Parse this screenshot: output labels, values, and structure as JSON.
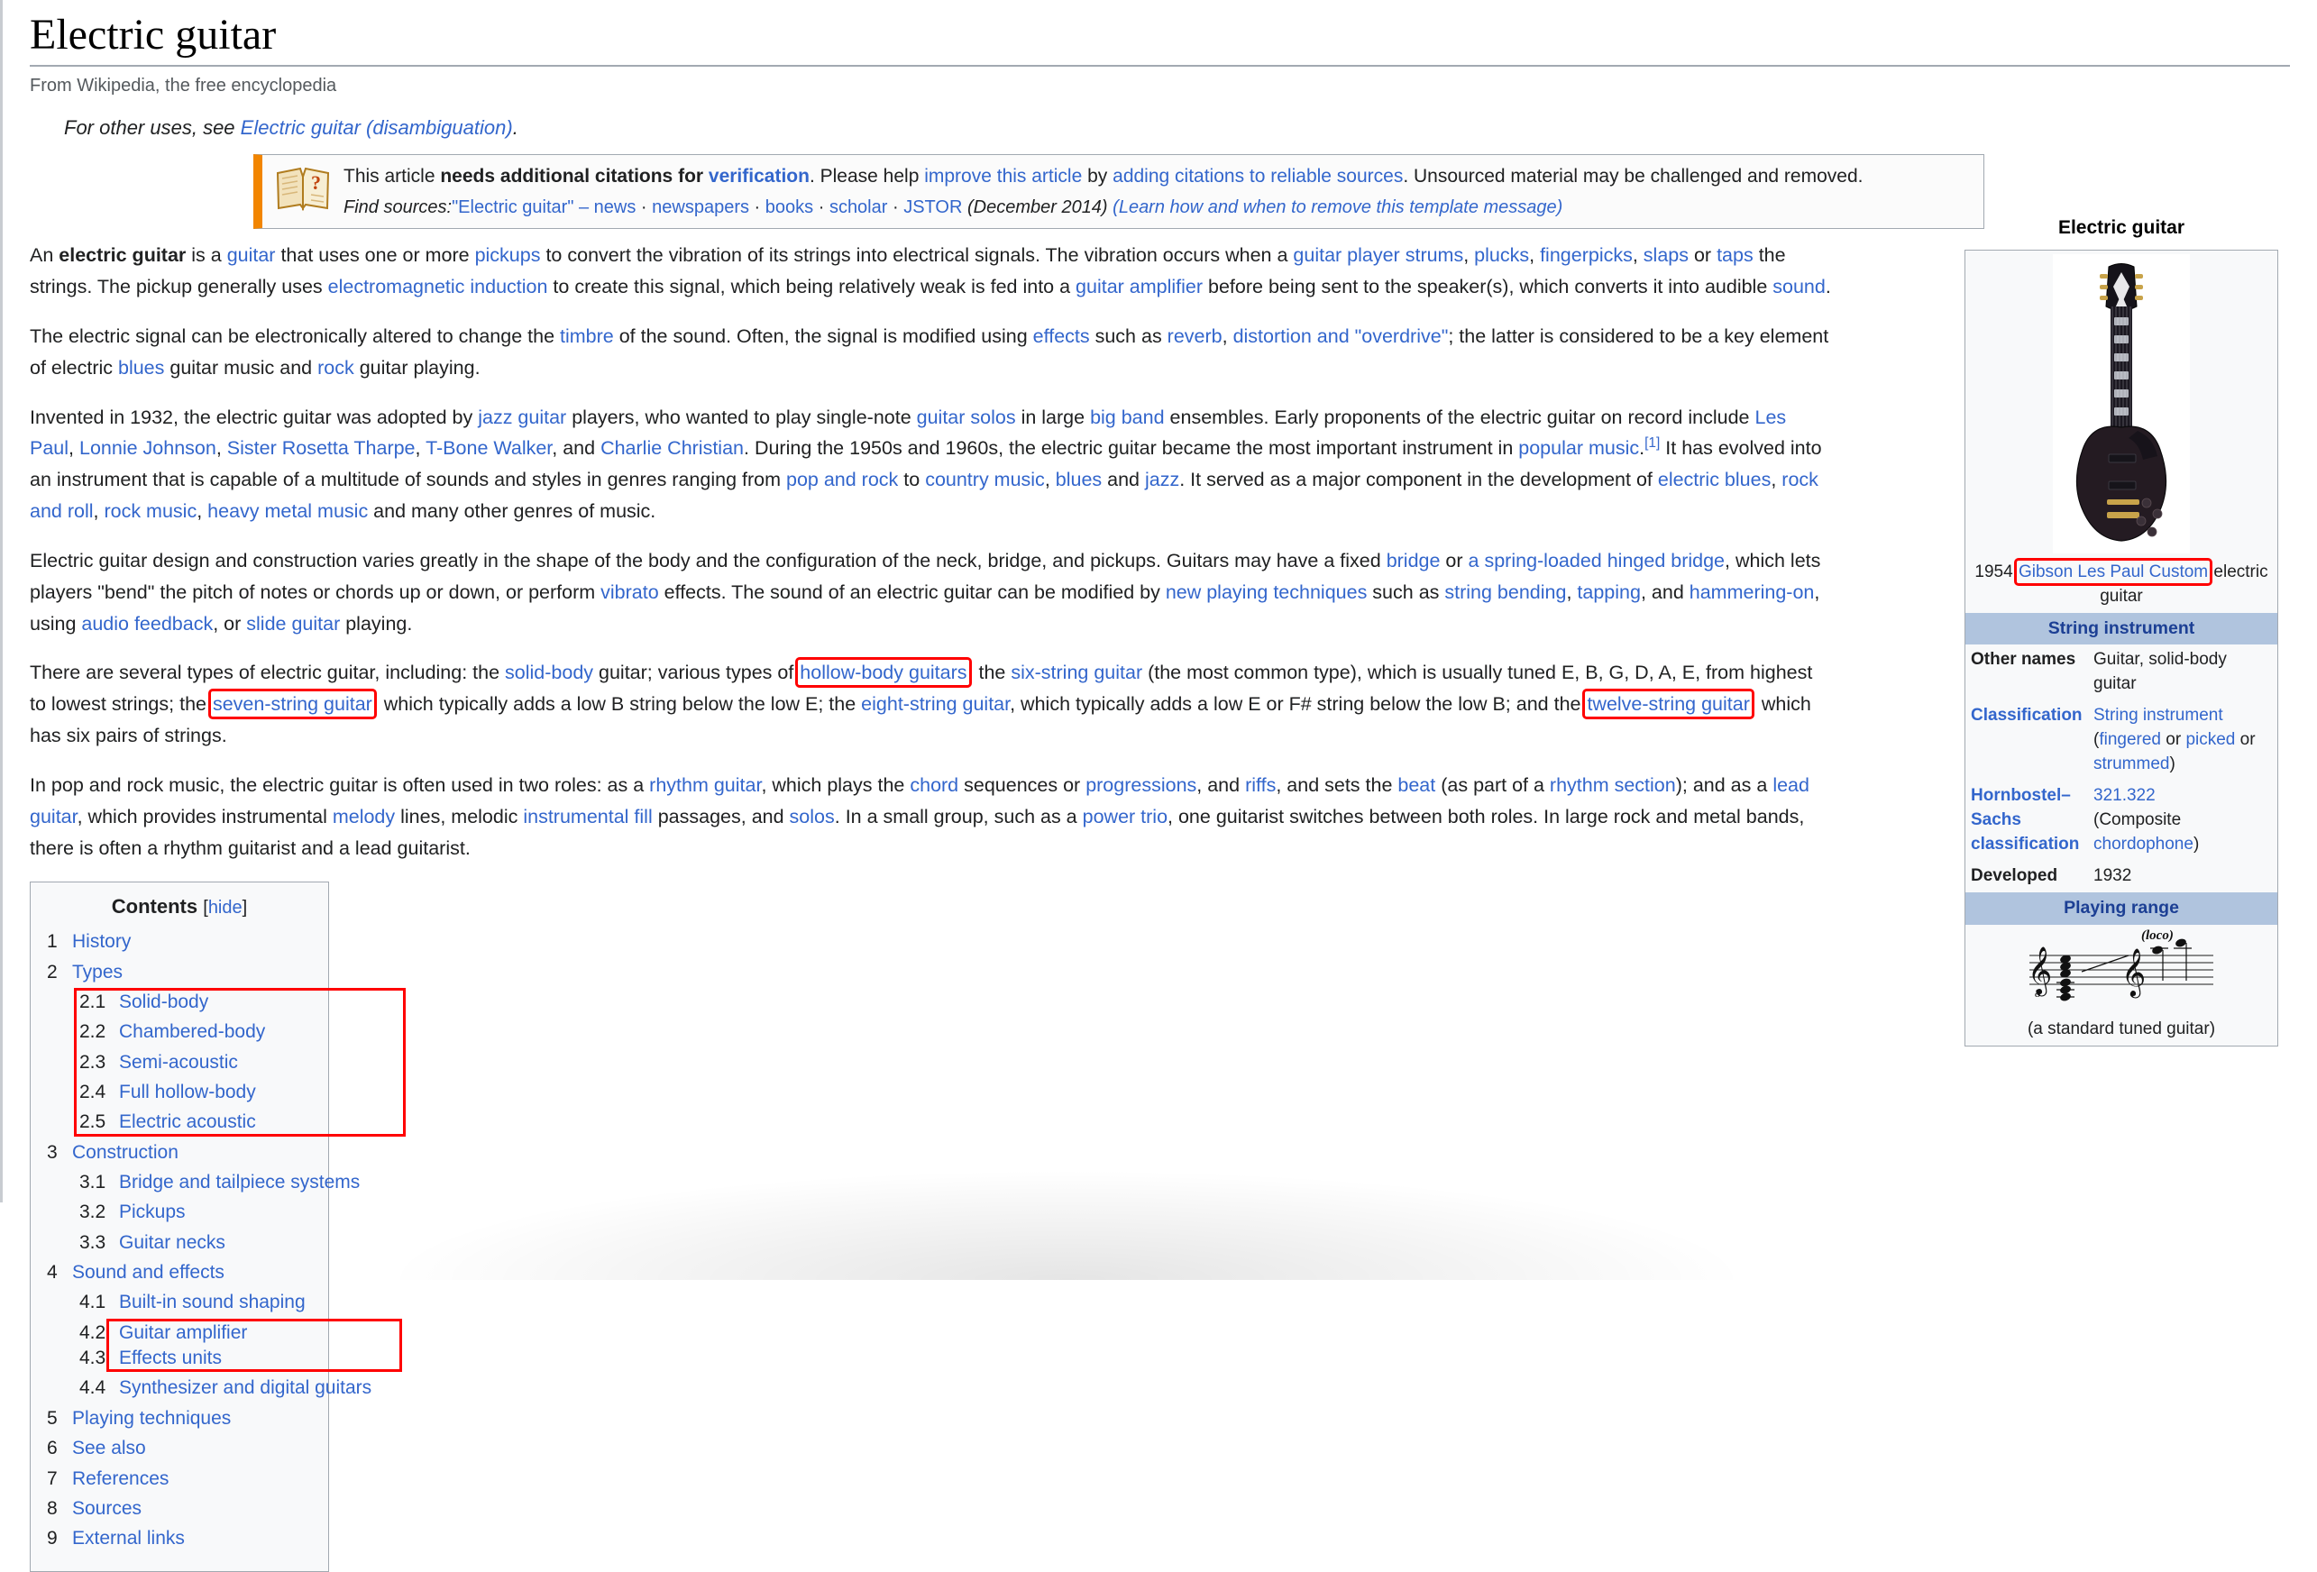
{
  "article": {
    "title": "Electric guitar",
    "tagline": "From Wikipedia, the free encyclopedia",
    "hatnote_prefix": "For other uses, see ",
    "hatnote_link": "Electric guitar (disambiguation)",
    "hatnote_suffix": "."
  },
  "ambox": {
    "icon": "open-book-question-icon",
    "line1_a": "This article ",
    "line1_b_bold": "needs additional citations for ",
    "line1_c_boldlink": "verification",
    "line1_d": ". Please help ",
    "line1_e_link": "improve this article",
    "line1_f": " by ",
    "line1_g_link": "adding citations to reliable sources",
    "line1_h": ". Unsourced material may be challenged and removed.",
    "find_sources_label": "Find sources:",
    "find_sources_query": "\"Electric guitar\"",
    "dash": "–",
    "sources": [
      "news",
      "newspapers",
      "books",
      "scholar",
      "JSTOR"
    ],
    "date": "(December 2014)",
    "learn_more": "(Learn how and when to remove this template message)"
  },
  "paragraphs": {
    "p1": {
      "t1": "An ",
      "bold1": "electric guitar",
      "t2": " is a ",
      "l1": "guitar",
      "t3": " that uses one or more ",
      "l2": "pickups",
      "t4": " to convert the vibration of its strings into electrical signals. The vibration occurs when a ",
      "l3": "guitar player",
      "t5": " ",
      "l4": "strums",
      "t6": ", ",
      "l5": "plucks",
      "t7": ", ",
      "l6": "fingerpicks",
      "t8": ", ",
      "l7": "slaps",
      "t9": " or ",
      "l8": "taps",
      "t10": " the strings. The pickup generally uses ",
      "l9": "electromagnetic induction",
      "t11": " to create this signal, which being relatively weak is fed into a ",
      "l10": "guitar amplifier",
      "t12": " before being sent to the speaker(s), which converts it into audible ",
      "l11": "sound",
      "t13": "."
    },
    "p2": {
      "t1": "The electric signal can be electronically altered to change the ",
      "l1": "timbre",
      "t2": " of the sound. Often, the signal is modified using ",
      "l2": "effects",
      "t3": " such as ",
      "l3": "reverb",
      "t4": ", ",
      "l4": "distortion and \"overdrive\"",
      "t5": "; the latter is considered to be a key element of electric ",
      "l5": "blues",
      "t6": " guitar music and ",
      "l6": "rock",
      "t7": " guitar playing."
    },
    "p3": {
      "t1": "Invented in 1932, the electric guitar was adopted by ",
      "l1": "jazz guitar",
      "t2": " players, who wanted to play single-note ",
      "l2": "guitar solos",
      "t3": " in large ",
      "l3": "big band",
      "t4": " ensembles. Early proponents of the electric guitar on record include ",
      "l4": "Les Paul",
      "t5": ", ",
      "l5": "Lonnie Johnson",
      "t6": ", ",
      "l6": "Sister Rosetta Tharpe",
      "t7": ", ",
      "l7": "T-Bone Walker",
      "t8": ", and ",
      "l8": "Charlie Christian",
      "t9": ". During the 1950s and 1960s, the electric guitar became the most important instrument in ",
      "l9": "popular music",
      "ref": "[1]",
      "t10": " It has evolved into an instrument that is capable of a multitude of sounds and styles in genres ranging from ",
      "l10": "pop and rock",
      "t11": " to ",
      "l11": "country music",
      "t12": ", ",
      "l12": "blues",
      "t13": " and ",
      "l13": "jazz",
      "t14": ". It served as a major component in the development of ",
      "l14": "electric blues",
      "t15": ", ",
      "l15": "rock and roll",
      "t16": ", ",
      "l16": "rock music",
      "t17": ", ",
      "l17": "heavy metal music",
      "t18": " and many other genres of music."
    },
    "p4": {
      "t1": "Electric guitar design and construction varies greatly in the shape of the body and the configuration of the neck, bridge, and pickups. Guitars may have a fixed ",
      "l1": "bridge",
      "t2": " or ",
      "l2": "a spring-loaded hinged bridge",
      "t3": ", which lets players \"bend\" the pitch of notes or chords up or down, or perform ",
      "l3": "vibrato",
      "t4": " effects. The sound of an electric guitar can be modified by ",
      "l4": "new playing techniques",
      "t5": " such as ",
      "l5": "string bending",
      "t6": ", ",
      "l6": "tapping",
      "t7": ", and ",
      "l7": "hammering-on",
      "t8": ", using ",
      "l8": "audio feedback",
      "t9": ", or ",
      "l9": "slide guitar",
      "t10": " playing."
    },
    "p5": {
      "t1": "There are several types of electric guitar, including: the ",
      "l1": "solid-body",
      "t2": " guitar; various types of ",
      "l2_boxed": "hollow-body guitars",
      "t3": "; the ",
      "l3": "six-string guitar",
      "t4": " (the most common type), which is usually tuned E, B, G, D, A, E, from highest to lowest strings; the ",
      "l4_boxed": "seven-string guitar",
      "t5": ", which typically adds a low B string below the low E; the ",
      "l5": "eight-string guitar",
      "t6": ", which typically adds a low E or F# string below the low B; and the ",
      "l6_boxed": "twelve-string guitar",
      "t7": ", which has six pairs of strings."
    },
    "p6": {
      "t1": "In pop and rock music, the electric guitar is often used in two roles: as a ",
      "l1": "rhythm guitar",
      "t2": ", which plays the ",
      "l2": "chord",
      "t3": " sequences or ",
      "l3": "progressions",
      "t4": ", and ",
      "l4": "riffs",
      "t5": ", and sets the ",
      "l5": "beat",
      "t6": " (as part of a ",
      "l6": "rhythm section",
      "t7": "); and as a ",
      "l7": "lead guitar",
      "t8": ", which provides instrumental ",
      "l8": "melody",
      "t9": " lines, melodic ",
      "l9": "instrumental fill",
      "t10": " passages, and ",
      "l10": "solos",
      "t11": ". In a small group, such as a ",
      "l11": "power trio",
      "t12": ", one guitarist switches between both roles. In large rock and metal bands, there is often a rhythm guitarist and a lead guitarist."
    }
  },
  "toc": {
    "heading": "Contents",
    "toggle_open": "[",
    "toggle_label": "hide",
    "toggle_close": "]",
    "items": [
      {
        "num": "1",
        "label": "History"
      },
      {
        "num": "2",
        "label": "Types",
        "children": [
          {
            "num": "2.1",
            "label": "Solid-body"
          },
          {
            "num": "2.2",
            "label": "Chambered-body"
          },
          {
            "num": "2.3",
            "label": "Semi-acoustic"
          },
          {
            "num": "2.4",
            "label": "Full hollow-body"
          },
          {
            "num": "2.5",
            "label": "Electric acoustic"
          }
        ]
      },
      {
        "num": "3",
        "label": "Construction",
        "children": [
          {
            "num": "3.1",
            "label": "Bridge and tailpiece systems"
          },
          {
            "num": "3.2",
            "label": "Pickups"
          },
          {
            "num": "3.3",
            "label": "Guitar necks"
          }
        ]
      },
      {
        "num": "4",
        "label": "Sound and effects",
        "children": [
          {
            "num": "4.1",
            "label": "Built-in sound shaping"
          },
          {
            "num": "4.2",
            "label": "Guitar amplifier"
          },
          {
            "num": "4.3",
            "label": "Effects units"
          },
          {
            "num": "4.4",
            "label": "Synthesizer and digital guitars"
          }
        ]
      },
      {
        "num": "5",
        "label": "Playing techniques"
      },
      {
        "num": "6",
        "label": "See also"
      },
      {
        "num": "7",
        "label": "References"
      },
      {
        "num": "8",
        "label": "Sources"
      },
      {
        "num": "9",
        "label": "External links"
      }
    ]
  },
  "infobox": {
    "title": "Electric guitar",
    "image_alt": "gibson-les-paul-custom-photo",
    "caption_prefix": "1954 ",
    "caption_link": "Gibson Les Paul Custom",
    "caption_suffix": " electric guitar",
    "section_header_1": "String instrument",
    "rows": [
      {
        "label": "Other names",
        "label_link": false,
        "value_plain": "Guitar, solid-body guitar"
      },
      {
        "label": "Classification",
        "label_link": true,
        "value_link1": "String instrument",
        "value_mid1": " (",
        "value_link2": "fingered",
        "value_mid2": " or ",
        "value_link3": "picked",
        "value_mid3": " or ",
        "value_link4": "strummed",
        "value_end": ")"
      },
      {
        "label": "Hornbostel–Sachs classification",
        "label_link": true,
        "value_link1": "321.322",
        "value_mid1": "(Composite ",
        "value_link2": "chordophone",
        "value_end": ")"
      },
      {
        "label": "Developed",
        "label_link": false,
        "value_plain": "1932"
      }
    ],
    "section_header_2": "Playing range",
    "range_annotation": "(loco)",
    "range_caption": "(a standard tuned guitar)"
  },
  "colors": {
    "link": "#3366cc",
    "annotation_red": "#ff0000",
    "infobox_header": "#b0c4de",
    "ambox_accent": "#f28500"
  }
}
